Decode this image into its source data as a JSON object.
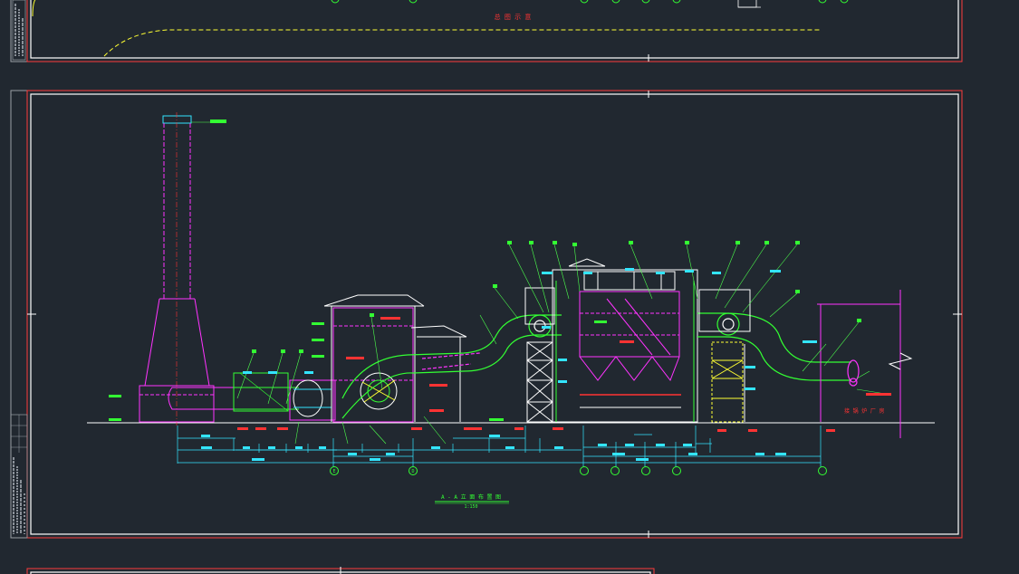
{
  "drawing": {
    "top_sheet_label": "总 图 示 意",
    "main_title": "A - A 立 面 布 置 图",
    "main_scale": "1:150",
    "right_note": "接 锅 炉 厂 房",
    "grid_labels_bottom": [
      "E",
      "D",
      "",
      "",
      "",
      "",
      ""
    ],
    "colors": {
      "background": "#212830",
      "frame": "#ff3b3b",
      "border": "#ffffff",
      "equipment": "#ff33ff",
      "duct": "#33ff33",
      "dimension": "#33e5ff",
      "annotation": "#ff3333",
      "leader": "#4cff4c",
      "highlight": "#ffff33"
    }
  }
}
